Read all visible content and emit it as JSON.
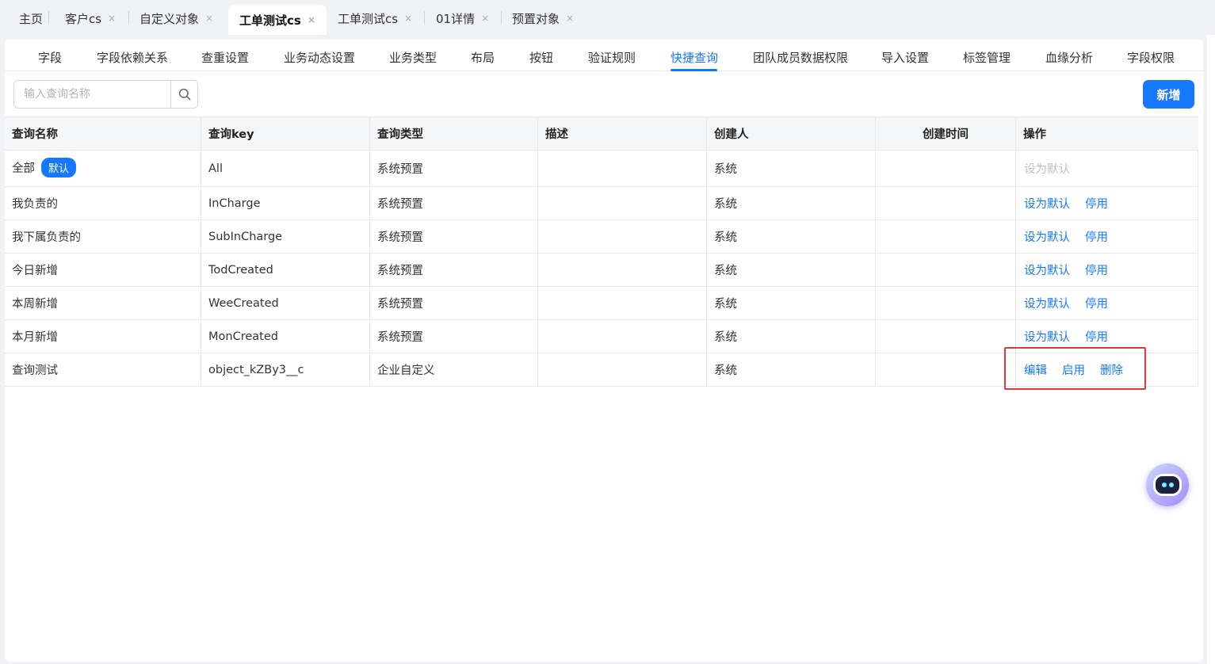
{
  "tabs": [
    {
      "label": "主页",
      "closable": false,
      "active": false
    },
    {
      "label": "客户cs",
      "closable": true,
      "active": false
    },
    {
      "label": "自定义对象",
      "closable": true,
      "active": false
    },
    {
      "label": "工单测试cs",
      "closable": true,
      "active": true
    },
    {
      "label": "工单测试cs",
      "closable": true,
      "active": false
    },
    {
      "label": "01详情",
      "closable": true,
      "active": false
    },
    {
      "label": "预置对象",
      "closable": true,
      "active": false
    }
  ],
  "close_glyph": "×",
  "subnav": [
    "字段",
    "字段依赖关系",
    "查重设置",
    "业务动态设置",
    "业务类型",
    "布局",
    "按钮",
    "验证规则",
    "快捷查询",
    "团队成员数据权限",
    "导入设置",
    "标签管理",
    "血缘分析",
    "字段权限"
  ],
  "subnav_active": "快捷查询",
  "search": {
    "placeholder": "输入查询名称",
    "value": ""
  },
  "add_button": "新增",
  "table": {
    "columns": [
      "查询名称",
      "查询key",
      "查询类型",
      "描述",
      "创建人",
      "创建时间",
      "操作"
    ],
    "rows": [
      {
        "name": "全部",
        "badge": "默认",
        "key": "All",
        "type": "系统预置",
        "desc": "",
        "creator": "系统",
        "created": "",
        "actions": [
          {
            "label": "设为默认",
            "enabled": false
          }
        ]
      },
      {
        "name": "我负责的",
        "badge": "",
        "key": "InCharge",
        "type": "系统预置",
        "desc": "",
        "creator": "系统",
        "created": "",
        "actions": [
          {
            "label": "设为默认",
            "enabled": true
          },
          {
            "label": "停用",
            "enabled": true
          }
        ]
      },
      {
        "name": "我下属负责的",
        "badge": "",
        "key": "SubInCharge",
        "type": "系统预置",
        "desc": "",
        "creator": "系统",
        "created": "",
        "actions": [
          {
            "label": "设为默认",
            "enabled": true
          },
          {
            "label": "停用",
            "enabled": true
          }
        ]
      },
      {
        "name": "今日新增",
        "badge": "",
        "key": "TodCreated",
        "type": "系统预置",
        "desc": "",
        "creator": "系统",
        "created": "",
        "actions": [
          {
            "label": "设为默认",
            "enabled": true
          },
          {
            "label": "停用",
            "enabled": true
          }
        ]
      },
      {
        "name": "本周新增",
        "badge": "",
        "key": "WeeCreated",
        "type": "系统预置",
        "desc": "",
        "creator": "系统",
        "created": "",
        "actions": [
          {
            "label": "设为默认",
            "enabled": true
          },
          {
            "label": "停用",
            "enabled": true
          }
        ]
      },
      {
        "name": "本月新增",
        "badge": "",
        "key": "MonCreated",
        "type": "系统预置",
        "desc": "",
        "creator": "系统",
        "created": "",
        "actions": [
          {
            "label": "设为默认",
            "enabled": true
          },
          {
            "label": "停用",
            "enabled": true
          }
        ]
      },
      {
        "name": "查询测试",
        "badge": "",
        "key": "object_kZBy3__c",
        "type": "企业自定义",
        "desc": "",
        "creator": "系统",
        "created": "",
        "actions": [
          {
            "label": "编辑",
            "enabled": true
          },
          {
            "label": "启用",
            "enabled": true
          },
          {
            "label": "删除",
            "enabled": true
          }
        ]
      }
    ]
  },
  "colors": {
    "accent": "#1677ff",
    "highlight_box": "#e53935",
    "disabled_text": "#c0c0c0"
  },
  "icons": {
    "search": "search-icon",
    "assistant": "robot-assistant-icon"
  }
}
